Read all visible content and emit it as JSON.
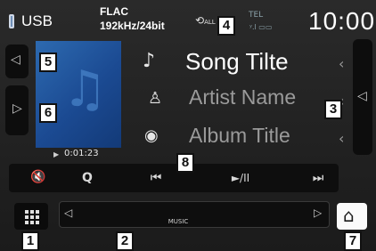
{
  "status": {
    "source": "USB",
    "format_line1": "FLAC",
    "format_line2": "192kHz/24bit",
    "loop_label": "ALL",
    "tel_label": "TEL",
    "tel_sub": "ʸ.l ▭▭",
    "clock": "10:00"
  },
  "track": {
    "song": "Song Tilte",
    "artist": "Artist Name",
    "album": "Album Title",
    "elapsed": "0:01:23"
  },
  "controls": {
    "mute_icon": "🔇",
    "search_icon": "Q",
    "prev_icon": "⏮",
    "playpause_icon": "►/II",
    "next_icon": "⏭"
  },
  "bottom": {
    "music_label": "MUSIC"
  },
  "callouts": {
    "c1": "1",
    "c2": "2",
    "c3": "3",
    "c4": "4",
    "c5": "5",
    "c6": "6",
    "c7": "7",
    "c8": "8"
  },
  "colors": {
    "background": "#c9e8cf",
    "screen": "#1e1e1e",
    "album_art": "#2d6ab0",
    "callout_fill": "#ffffff"
  }
}
